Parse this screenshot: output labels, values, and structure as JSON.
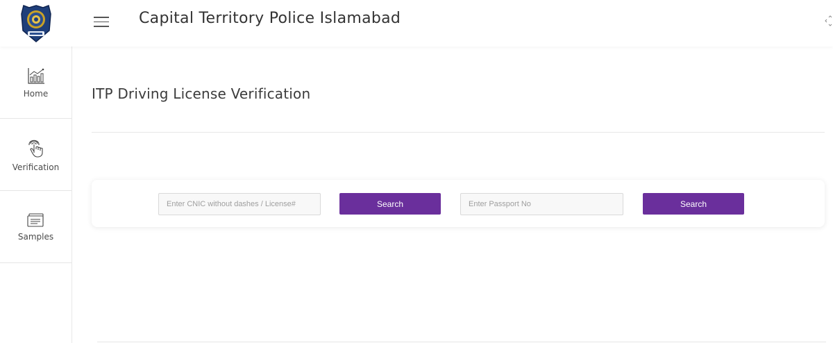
{
  "header": {
    "title": "Capital Territory Police Islamabad"
  },
  "sidebar": {
    "items": [
      {
        "label": "Home",
        "icon": "bar-chart-icon"
      },
      {
        "label": "Verification",
        "icon": "fingerprint-touch-icon"
      },
      {
        "label": "Samples",
        "icon": "card-stack-icon"
      }
    ]
  },
  "main": {
    "page_title": "ITP Driving License Verification",
    "search": {
      "cnic_placeholder": "Enter CNIC without dashes / License#",
      "cnic_value": "",
      "cnic_button_label": "Search",
      "passport_placeholder": "Enter Passport No",
      "passport_value": "",
      "passport_button_label": "Search"
    }
  },
  "colors": {
    "accent": "#6a2f9c",
    "badge_navy": "#1f3f7a",
    "badge_gold": "#c9a227"
  }
}
